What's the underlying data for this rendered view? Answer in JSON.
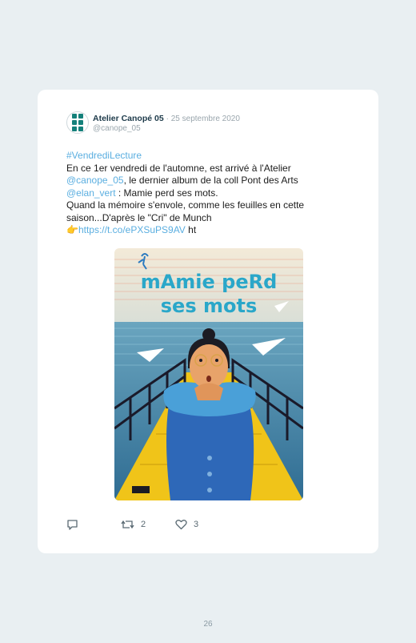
{
  "tweet": {
    "author_name": "Atelier Canopé 05",
    "date": "· 25 septembre 2020",
    "handle": "@canope_05",
    "hashtag": "#VendrediLecture",
    "line1": "En ce 1er vendredi de l'automne, est arrivé à l'Atelier",
    "mention1": "@canope_05",
    "line2_rest": ", le dernier album de la coll Pont des Arts",
    "mention2": "@elan_vert",
    "line3_rest": " : Mamie perd ses mots.",
    "line4": "Quand la mémoire s'envole, comme les feuilles en cette",
    "line5": "saison...D'après le \"Cri\" de Munch",
    "emoji": "👉",
    "url": "https://t.co/ePXSuPS9AV",
    "url_tail": " ht",
    "retweets": "2",
    "likes": "3"
  },
  "cover": {
    "title_line1": "mAmie peRd",
    "title_line2": "ses mots",
    "colors": {
      "sky": "#7fb6cc",
      "sea": "#3e7ea0",
      "deck": "#f0c419",
      "coat": "#2e68b8",
      "fur": "#4aa0d8",
      "title": "#2aa7c9"
    }
  },
  "page_number": "26",
  "icons": [
    "reply-icon",
    "retweet-icon",
    "heart-icon"
  ]
}
